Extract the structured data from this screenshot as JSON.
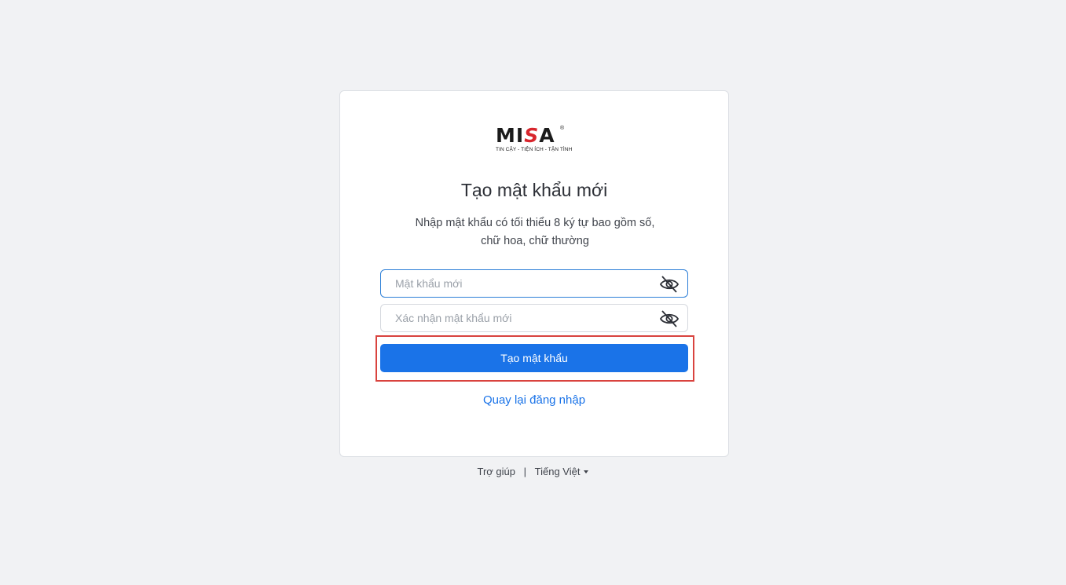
{
  "logo": {
    "word_pre": "MI",
    "word_s": "S",
    "word_post": "A",
    "registered": "®",
    "tagline": "TIN CẬY - TIỆN ÍCH - TẬN TÌNH"
  },
  "page": {
    "title": "Tạo mật khẩu mới",
    "description_line1": "Nhập mật khẩu có tối thiểu 8 ký tự bao gồm số,",
    "description_line2": "chữ hoa, chữ thường"
  },
  "form": {
    "new_password": {
      "placeholder": "Mật khẩu mới",
      "value": "",
      "icon": "eye-off-icon"
    },
    "confirm_password": {
      "placeholder": "Xác nhận mật khẩu mới",
      "value": "",
      "icon": "eye-off-icon"
    },
    "submit_label": "Tạo mật khẩu",
    "back_link": "Quay lại đăng nhập"
  },
  "footer": {
    "help": "Trợ giúp",
    "separator": "|",
    "language": "Tiếng Việt",
    "language_icon": "caret-down-icon"
  },
  "colors": {
    "primary": "#1a73e8",
    "highlight": "#d9433e",
    "background": "#f1f2f4",
    "brand_red": "#d8262d"
  }
}
